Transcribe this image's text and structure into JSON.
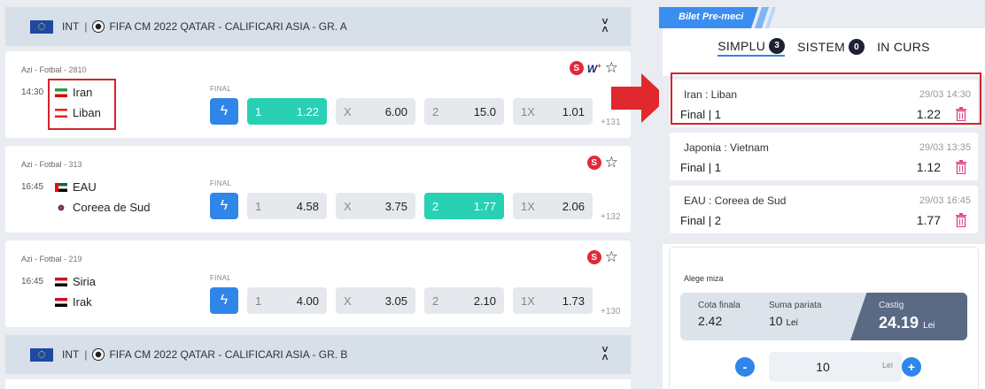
{
  "groups": [
    {
      "country": "INT",
      "competition": "FIFA CM 2022 QATAR - CALIFICARI ASIA - GR. A"
    },
    {
      "country": "INT",
      "competition": "FIFA CM 2022 QATAR - CALIFICARI ASIA - GR. B"
    }
  ],
  "matches": [
    {
      "league": "Azi - Fotbal",
      "league_id": "2810",
      "time": "14:30",
      "home": "Iran",
      "away": "Liban",
      "final_label": "FINAL",
      "odds": [
        {
          "label": "1",
          "value": "1.22"
        },
        {
          "label": "X",
          "value": "6.00"
        },
        {
          "label": "2",
          "value": "15.0"
        },
        {
          "label": "1X",
          "value": "1.01"
        }
      ],
      "more": "+131",
      "selected": "1"
    },
    {
      "league": "Azi - Fotbal",
      "league_id": "313",
      "time": "16:45",
      "home": "EAU",
      "away": "Coreea de Sud",
      "final_label": "FINAL",
      "odds": [
        {
          "label": "1",
          "value": "4.58"
        },
        {
          "label": "X",
          "value": "3.75"
        },
        {
          "label": "2",
          "value": "1.77"
        },
        {
          "label": "1X",
          "value": "2.06"
        }
      ],
      "more": "+132",
      "selected": "2"
    },
    {
      "league": "Azi - Fotbal",
      "league_id": "219",
      "time": "16:45",
      "home": "Siria",
      "away": "Irak",
      "final_label": "FINAL",
      "odds": [
        {
          "label": "1",
          "value": "4.00"
        },
        {
          "label": "X",
          "value": "3.05"
        },
        {
          "label": "2",
          "value": "2.10"
        },
        {
          "label": "1X",
          "value": "1.73"
        }
      ],
      "more": "+130",
      "selected": ""
    }
  ],
  "badges": {
    "s": "S",
    "w": "W",
    "w_plus": "+"
  },
  "slip": {
    "tab_label": "Bilet Pre-meci",
    "modes": [
      {
        "label": "SIMPLU",
        "count": "3"
      },
      {
        "label": "SISTEM",
        "count": "0"
      },
      {
        "label": "IN CURS",
        "count": ""
      }
    ],
    "bets": [
      {
        "teams": "Iran : Liban",
        "datetime": "29/03 14:30",
        "market": "Final | 1",
        "odds": "1.22"
      },
      {
        "teams": "Japonia : Vietnam",
        "datetime": "29/03 13:35",
        "market": "Final | 1",
        "odds": "1.12"
      },
      {
        "teams": "EAU : Coreea de Sud",
        "datetime": "29/03 16:45",
        "market": "Final | 2",
        "odds": "1.77"
      }
    ],
    "stake": {
      "title": "Alege miza",
      "total_odds_label": "Cota finala",
      "total_odds": "2.42",
      "stake_label": "Suma pariata",
      "stake_value": "10",
      "currency": "Lei",
      "win_label": "Castig",
      "win_value": "24.19",
      "input_value": "10",
      "minus": "-",
      "plus": "+"
    }
  },
  "colors": {
    "selected_odd": "#28d0b4",
    "accent_blue": "#2f86e8",
    "highlight_red": "#d4232b",
    "dark": "#1e2133"
  }
}
